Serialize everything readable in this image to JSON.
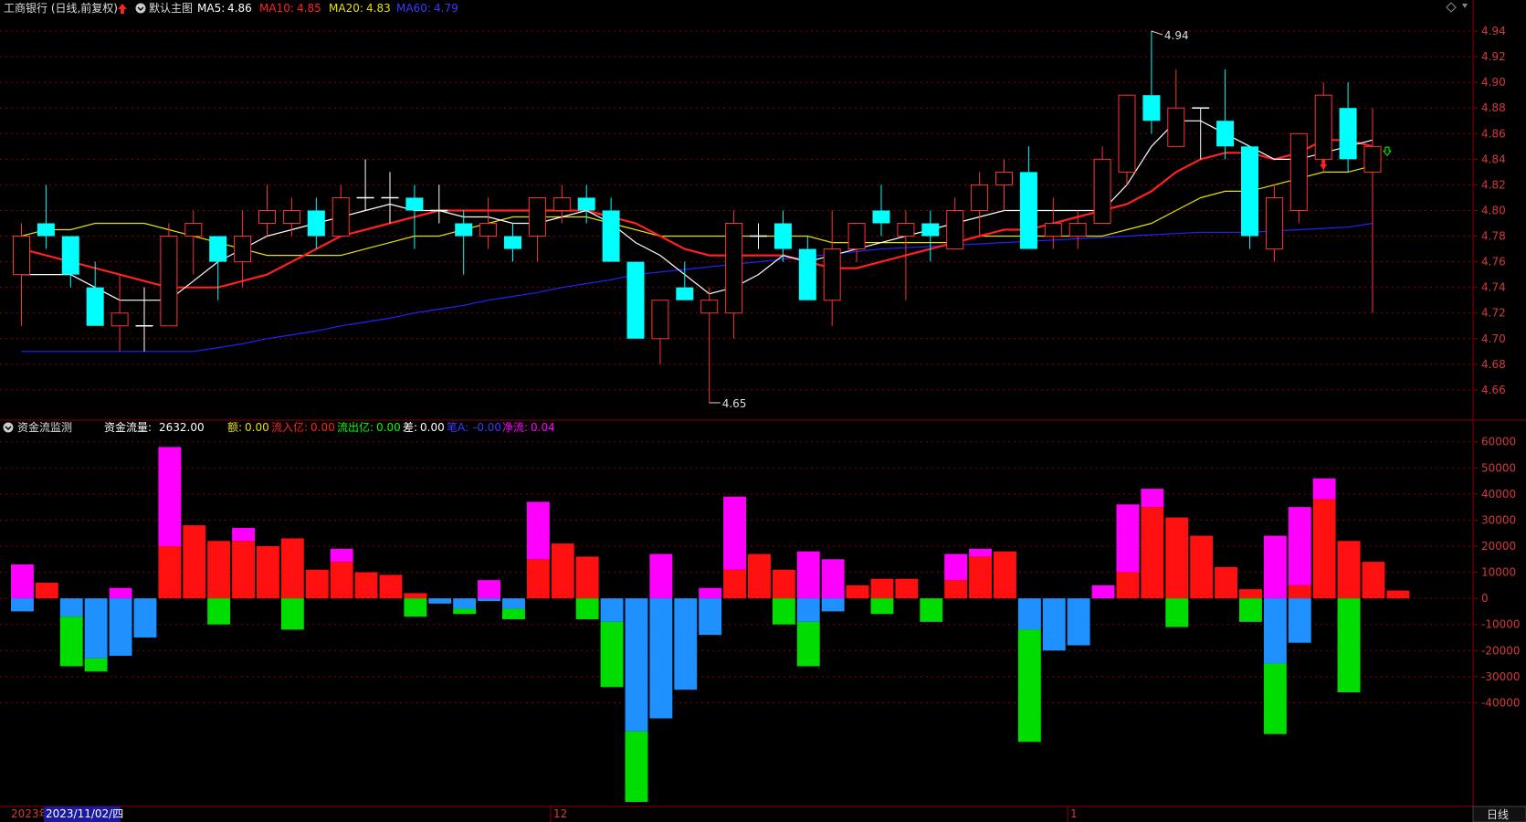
{
  "header": {
    "stock_name": "工商银行 (日线,前复权)",
    "template_name": "默认主图",
    "ma5_label": "MA5:",
    "ma5_value": "4.86",
    "ma10_label": "MA10:",
    "ma10_value": "4.85",
    "ma20_label": "MA20:",
    "ma20_value": "4.83",
    "ma60_label": "MA60:",
    "ma60_value": "4.79"
  },
  "indicator_header": {
    "title": "资金流监测",
    "flow_label": "资金流量:",
    "flow_value": "2632.00",
    "amt_label": "额:",
    "amt_value": "0.00",
    "in_label": "流入亿:",
    "in_value": "0.00",
    "out_label": "流出亿:",
    "out_value": "0.00",
    "diff_label": "差:",
    "diff_value": "0.00",
    "a_label": "笔A:",
    "a_value": "-0.00",
    "net_label": "净流:",
    "net_value": "0.04"
  },
  "bottom_bar": {
    "date_prefix": "2023年",
    "cursor_date": "2023/11/02/四",
    "month_12": "12",
    "month_1": "1",
    "period_button": "日线"
  },
  "annotations": {
    "high_label": "4.94",
    "low_label": "4.65"
  },
  "colors": {
    "up": "#ff3232",
    "down": "#00ffff",
    "ma5": "#ffffff",
    "ma10": "#ff2020",
    "ma20": "#e8e000",
    "ma60": "#2222ff",
    "grid": "#8b0000",
    "hist_red": "#ff1010",
    "hist_magenta": "#ff00ff",
    "hist_green": "#00dd00",
    "hist_blue": "#1e90ff"
  },
  "chart_data": [
    {
      "type": "candlestick",
      "title": "工商银行 (日线,前复权)",
      "ylim": [
        4.64,
        4.95
      ],
      "yticks": [
        4.94,
        4.92,
        4.9,
        4.88,
        4.86,
        4.84,
        4.82,
        4.8,
        4.78,
        4.76,
        4.74,
        4.72,
        4.7,
        4.68,
        4.66
      ],
      "candles": [
        {
          "o": 4.75,
          "c": 4.78,
          "h": 4.79,
          "l": 4.71
        },
        {
          "o": 4.79,
          "c": 4.78,
          "h": 4.82,
          "l": 4.77
        },
        {
          "o": 4.78,
          "c": 4.75,
          "h": 4.78,
          "l": 4.74
        },
        {
          "o": 4.74,
          "c": 4.71,
          "h": 4.76,
          "l": 4.71
        },
        {
          "o": 4.71,
          "c": 4.72,
          "h": 4.75,
          "l": 4.69
        },
        {
          "o": 4.71,
          "c": 4.71,
          "h": 4.74,
          "l": 4.69
        },
        {
          "o": 4.71,
          "c": 4.78,
          "h": 4.79,
          "l": 4.71
        },
        {
          "o": 4.78,
          "c": 4.79,
          "h": 4.8,
          "l": 4.75
        },
        {
          "o": 4.78,
          "c": 4.76,
          "h": 4.78,
          "l": 4.73
        },
        {
          "o": 4.76,
          "c": 4.78,
          "h": 4.8,
          "l": 4.74
        },
        {
          "o": 4.79,
          "c": 4.8,
          "h": 4.82,
          "l": 4.78
        },
        {
          "o": 4.79,
          "c": 4.8,
          "h": 4.81,
          "l": 4.78
        },
        {
          "o": 4.8,
          "c": 4.78,
          "h": 4.81,
          "l": 4.77
        },
        {
          "o": 4.78,
          "c": 4.81,
          "h": 4.82,
          "l": 4.78
        },
        {
          "o": 4.81,
          "c": 4.81,
          "h": 4.84,
          "l": 4.8
        },
        {
          "o": 4.81,
          "c": 4.81,
          "h": 4.83,
          "l": 4.79
        },
        {
          "o": 4.81,
          "c": 4.8,
          "h": 4.82,
          "l": 4.77
        },
        {
          "o": 4.8,
          "c": 4.8,
          "h": 4.82,
          "l": 4.79
        },
        {
          "o": 4.79,
          "c": 4.78,
          "h": 4.8,
          "l": 4.75
        },
        {
          "o": 4.78,
          "c": 4.79,
          "h": 4.81,
          "l": 4.77
        },
        {
          "o": 4.78,
          "c": 4.77,
          "h": 4.79,
          "l": 4.76
        },
        {
          "o": 4.78,
          "c": 4.81,
          "h": 4.81,
          "l": 4.76
        },
        {
          "o": 4.8,
          "c": 4.81,
          "h": 4.82,
          "l": 4.79
        },
        {
          "o": 4.81,
          "c": 4.8,
          "h": 4.82,
          "l": 4.79
        },
        {
          "o": 4.8,
          "c": 4.76,
          "h": 4.81,
          "l": 4.76
        },
        {
          "o": 4.76,
          "c": 4.7,
          "h": 4.76,
          "l": 4.7
        },
        {
          "o": 4.7,
          "c": 4.73,
          "h": 4.73,
          "l": 4.68
        },
        {
          "o": 4.74,
          "c": 4.73,
          "h": 4.76,
          "l": 4.73
        },
        {
          "o": 4.72,
          "c": 4.73,
          "h": 4.74,
          "l": 4.65
        },
        {
          "o": 4.72,
          "c": 4.79,
          "h": 4.8,
          "l": 4.7
        },
        {
          "o": 4.78,
          "c": 4.78,
          "h": 4.79,
          "l": 4.77
        },
        {
          "o": 4.79,
          "c": 4.77,
          "h": 4.8,
          "l": 4.76
        },
        {
          "o": 4.77,
          "c": 4.73,
          "h": 4.78,
          "l": 4.73
        },
        {
          "o": 4.73,
          "c": 4.77,
          "h": 4.8,
          "l": 4.71
        },
        {
          "o": 4.77,
          "c": 4.79,
          "h": 4.79,
          "l": 4.76
        },
        {
          "o": 4.8,
          "c": 4.79,
          "h": 4.82,
          "l": 4.78
        },
        {
          "o": 4.78,
          "c": 4.79,
          "h": 4.8,
          "l": 4.73
        },
        {
          "o": 4.79,
          "c": 4.78,
          "h": 4.8,
          "l": 4.76
        },
        {
          "o": 4.77,
          "c": 4.8,
          "h": 4.81,
          "l": 4.77
        },
        {
          "o": 4.8,
          "c": 4.82,
          "h": 4.83,
          "l": 4.78
        },
        {
          "o": 4.82,
          "c": 4.83,
          "h": 4.84,
          "l": 4.8
        },
        {
          "o": 4.83,
          "c": 4.77,
          "h": 4.85,
          "l": 4.77
        },
        {
          "o": 4.78,
          "c": 4.79,
          "h": 4.81,
          "l": 4.77
        },
        {
          "o": 4.78,
          "c": 4.79,
          "h": 4.8,
          "l": 4.77
        },
        {
          "o": 4.79,
          "c": 4.84,
          "h": 4.85,
          "l": 4.79
        },
        {
          "o": 4.83,
          "c": 4.89,
          "h": 4.89,
          "l": 4.82
        },
        {
          "o": 4.89,
          "c": 4.87,
          "h": 4.94,
          "l": 4.86
        },
        {
          "o": 4.85,
          "c": 4.88,
          "h": 4.91,
          "l": 4.85
        },
        {
          "o": 4.88,
          "c": 4.88,
          "h": 4.88,
          "l": 4.84
        },
        {
          "o": 4.87,
          "c": 4.85,
          "h": 4.91,
          "l": 4.84
        },
        {
          "o": 4.85,
          "c": 4.78,
          "h": 4.85,
          "l": 4.77
        },
        {
          "o": 4.77,
          "c": 4.81,
          "h": 4.82,
          "l": 4.76
        },
        {
          "o": 4.8,
          "c": 4.86,
          "h": 4.86,
          "l": 4.79
        },
        {
          "o": 4.84,
          "c": 4.89,
          "h": 4.9,
          "l": 4.83
        },
        {
          "o": 4.88,
          "c": 4.84,
          "h": 4.9,
          "l": 4.83
        },
        {
          "o": 4.83,
          "c": 4.85,
          "h": 4.88,
          "l": 4.72
        }
      ],
      "ma5": [
        4.75,
        4.75,
        4.75,
        4.74,
        4.73,
        4.73,
        4.73,
        4.745,
        4.76,
        4.77,
        4.78,
        4.785,
        4.79,
        4.795,
        4.8,
        4.805,
        4.8,
        4.8,
        4.795,
        4.795,
        4.79,
        4.79,
        4.795,
        4.8,
        4.79,
        4.775,
        4.765,
        4.75,
        4.735,
        4.74,
        4.75,
        4.765,
        4.76,
        4.765,
        4.77,
        4.775,
        4.78,
        4.785,
        4.79,
        4.795,
        4.8,
        4.8,
        4.8,
        4.8,
        4.8,
        4.82,
        4.85,
        4.87,
        4.87,
        4.86,
        4.85,
        4.84,
        4.84,
        4.845,
        4.85,
        4.855
      ],
      "ma10": [
        4.77,
        4.765,
        4.76,
        4.755,
        4.75,
        4.745,
        4.74,
        4.74,
        4.74,
        4.745,
        4.75,
        4.76,
        4.77,
        4.78,
        4.785,
        4.79,
        4.795,
        4.8,
        4.8,
        4.8,
        4.8,
        4.8,
        4.8,
        4.8,
        4.795,
        4.79,
        4.78,
        4.77,
        4.765,
        4.765,
        4.765,
        4.765,
        4.76,
        4.755,
        4.755,
        4.76,
        4.765,
        4.77,
        4.775,
        4.78,
        4.785,
        4.785,
        4.79,
        4.795,
        4.8,
        4.805,
        4.815,
        4.83,
        4.84,
        4.845,
        4.845,
        4.84,
        4.845,
        4.855,
        4.855,
        4.85
      ],
      "ma20": [
        4.78,
        4.785,
        4.785,
        4.79,
        4.79,
        4.79,
        4.785,
        4.78,
        4.775,
        4.77,
        4.765,
        4.765,
        4.765,
        4.765,
        4.77,
        4.775,
        4.78,
        4.78,
        4.785,
        4.79,
        4.795,
        4.795,
        4.795,
        4.795,
        4.79,
        4.785,
        4.78,
        4.78,
        4.78,
        4.78,
        4.78,
        4.78,
        4.78,
        4.775,
        4.775,
        4.775,
        4.775,
        4.775,
        4.775,
        4.78,
        4.78,
        4.78,
        4.78,
        4.78,
        4.78,
        4.785,
        4.79,
        4.8,
        4.81,
        4.815,
        4.815,
        4.82,
        4.825,
        4.83,
        4.83,
        4.835
      ],
      "ma60": [
        4.69,
        4.69,
        4.69,
        4.69,
        4.69,
        4.69,
        4.69,
        4.69,
        4.693,
        4.696,
        4.7,
        4.703,
        4.706,
        4.71,
        4.713,
        4.716,
        4.72,
        4.723,
        4.726,
        4.73,
        4.733,
        4.736,
        4.74,
        4.743,
        4.746,
        4.75,
        4.752,
        4.754,
        4.756,
        4.758,
        4.76,
        4.762,
        4.764,
        4.766,
        4.768,
        4.77,
        4.771,
        4.772,
        4.773,
        4.774,
        4.775,
        4.776,
        4.777,
        4.778,
        4.779,
        4.78,
        4.781,
        4.782,
        4.783,
        4.783,
        4.783,
        4.784,
        4.785,
        4.786,
        4.787,
        4.79
      ],
      "high_marker": {
        "index": 46,
        "value": 4.94
      },
      "low_marker": {
        "index": 28,
        "value": 4.65
      }
    },
    {
      "type": "bar",
      "title": "资金流监测",
      "ylim": [
        -78000,
        62000
      ],
      "yticks": [
        60000,
        50000,
        40000,
        30000,
        20000,
        10000,
        0,
        -10000,
        -20000,
        -30000,
        -40000
      ],
      "series": [
        {
          "name": "流入亿",
          "values": [
            0,
            6000,
            0,
            0,
            0,
            0,
            20000,
            28000,
            22000,
            22000,
            20000,
            23000,
            11000,
            14000,
            10000,
            9000,
            2000,
            0,
            0,
            0,
            0,
            15000,
            21000,
            16000,
            0,
            0,
            0,
            0,
            0,
            11000,
            17000,
            11000,
            0,
            0,
            5000,
            7500,
            7500,
            0,
            7000,
            16000,
            18000,
            0,
            0,
            0,
            0,
            10000,
            35000,
            31000,
            24000,
            12000,
            3500,
            0,
            5000,
            38000,
            22000,
            14000,
            3000
          ]
        },
        {
          "name": "magenta",
          "values": [
            13000,
            0,
            0,
            0,
            4000,
            0,
            58000,
            0,
            0,
            27000,
            0,
            0,
            0,
            19000,
            0,
            0,
            0,
            0,
            0,
            7000,
            0,
            37000,
            0,
            0,
            0,
            0,
            17000,
            0,
            4000,
            39000,
            0,
            0,
            18000,
            15000,
            0,
            0,
            0,
            0,
            17000,
            19000,
            0,
            0,
            0,
            0,
            5000,
            36000,
            42000,
            0,
            0,
            0,
            0,
            24000,
            35000,
            46000,
            0,
            0,
            0
          ]
        },
        {
          "name": "流出亿",
          "values": [
            0,
            0,
            -26000,
            -28000,
            0,
            0,
            0,
            0,
            -10000,
            0,
            0,
            -12000,
            0,
            0,
            0,
            0,
            -7000,
            0,
            -6000,
            0,
            -8000,
            0,
            0,
            -8000,
            -34000,
            -78000,
            0,
            0,
            0,
            0,
            0,
            -10000,
            -26000,
            0,
            0,
            -6000,
            0,
            -9000,
            0,
            0,
            0,
            -55000,
            0,
            0,
            0,
            0,
            0,
            -11000,
            0,
            0,
            -9000,
            -52000,
            0,
            0,
            -36000,
            0,
            0
          ]
        },
        {
          "name": "blue",
          "values": [
            -5000,
            0,
            -7000,
            -23000,
            -22000,
            -15000,
            0,
            0,
            0,
            0,
            0,
            0,
            0,
            0,
            0,
            0,
            0,
            -2000,
            -4000,
            -1000,
            -4000,
            0,
            0,
            0,
            -9000,
            -51000,
            -46000,
            -35000,
            -14000,
            0,
            0,
            0,
            -9000,
            -5000,
            0,
            0,
            0,
            0,
            0,
            0,
            0,
            -12000,
            -20000,
            -18000,
            0,
            0,
            0,
            0,
            0,
            0,
            0,
            -25000,
            -17000,
            0,
            0,
            0,
            0
          ]
        }
      ]
    }
  ]
}
